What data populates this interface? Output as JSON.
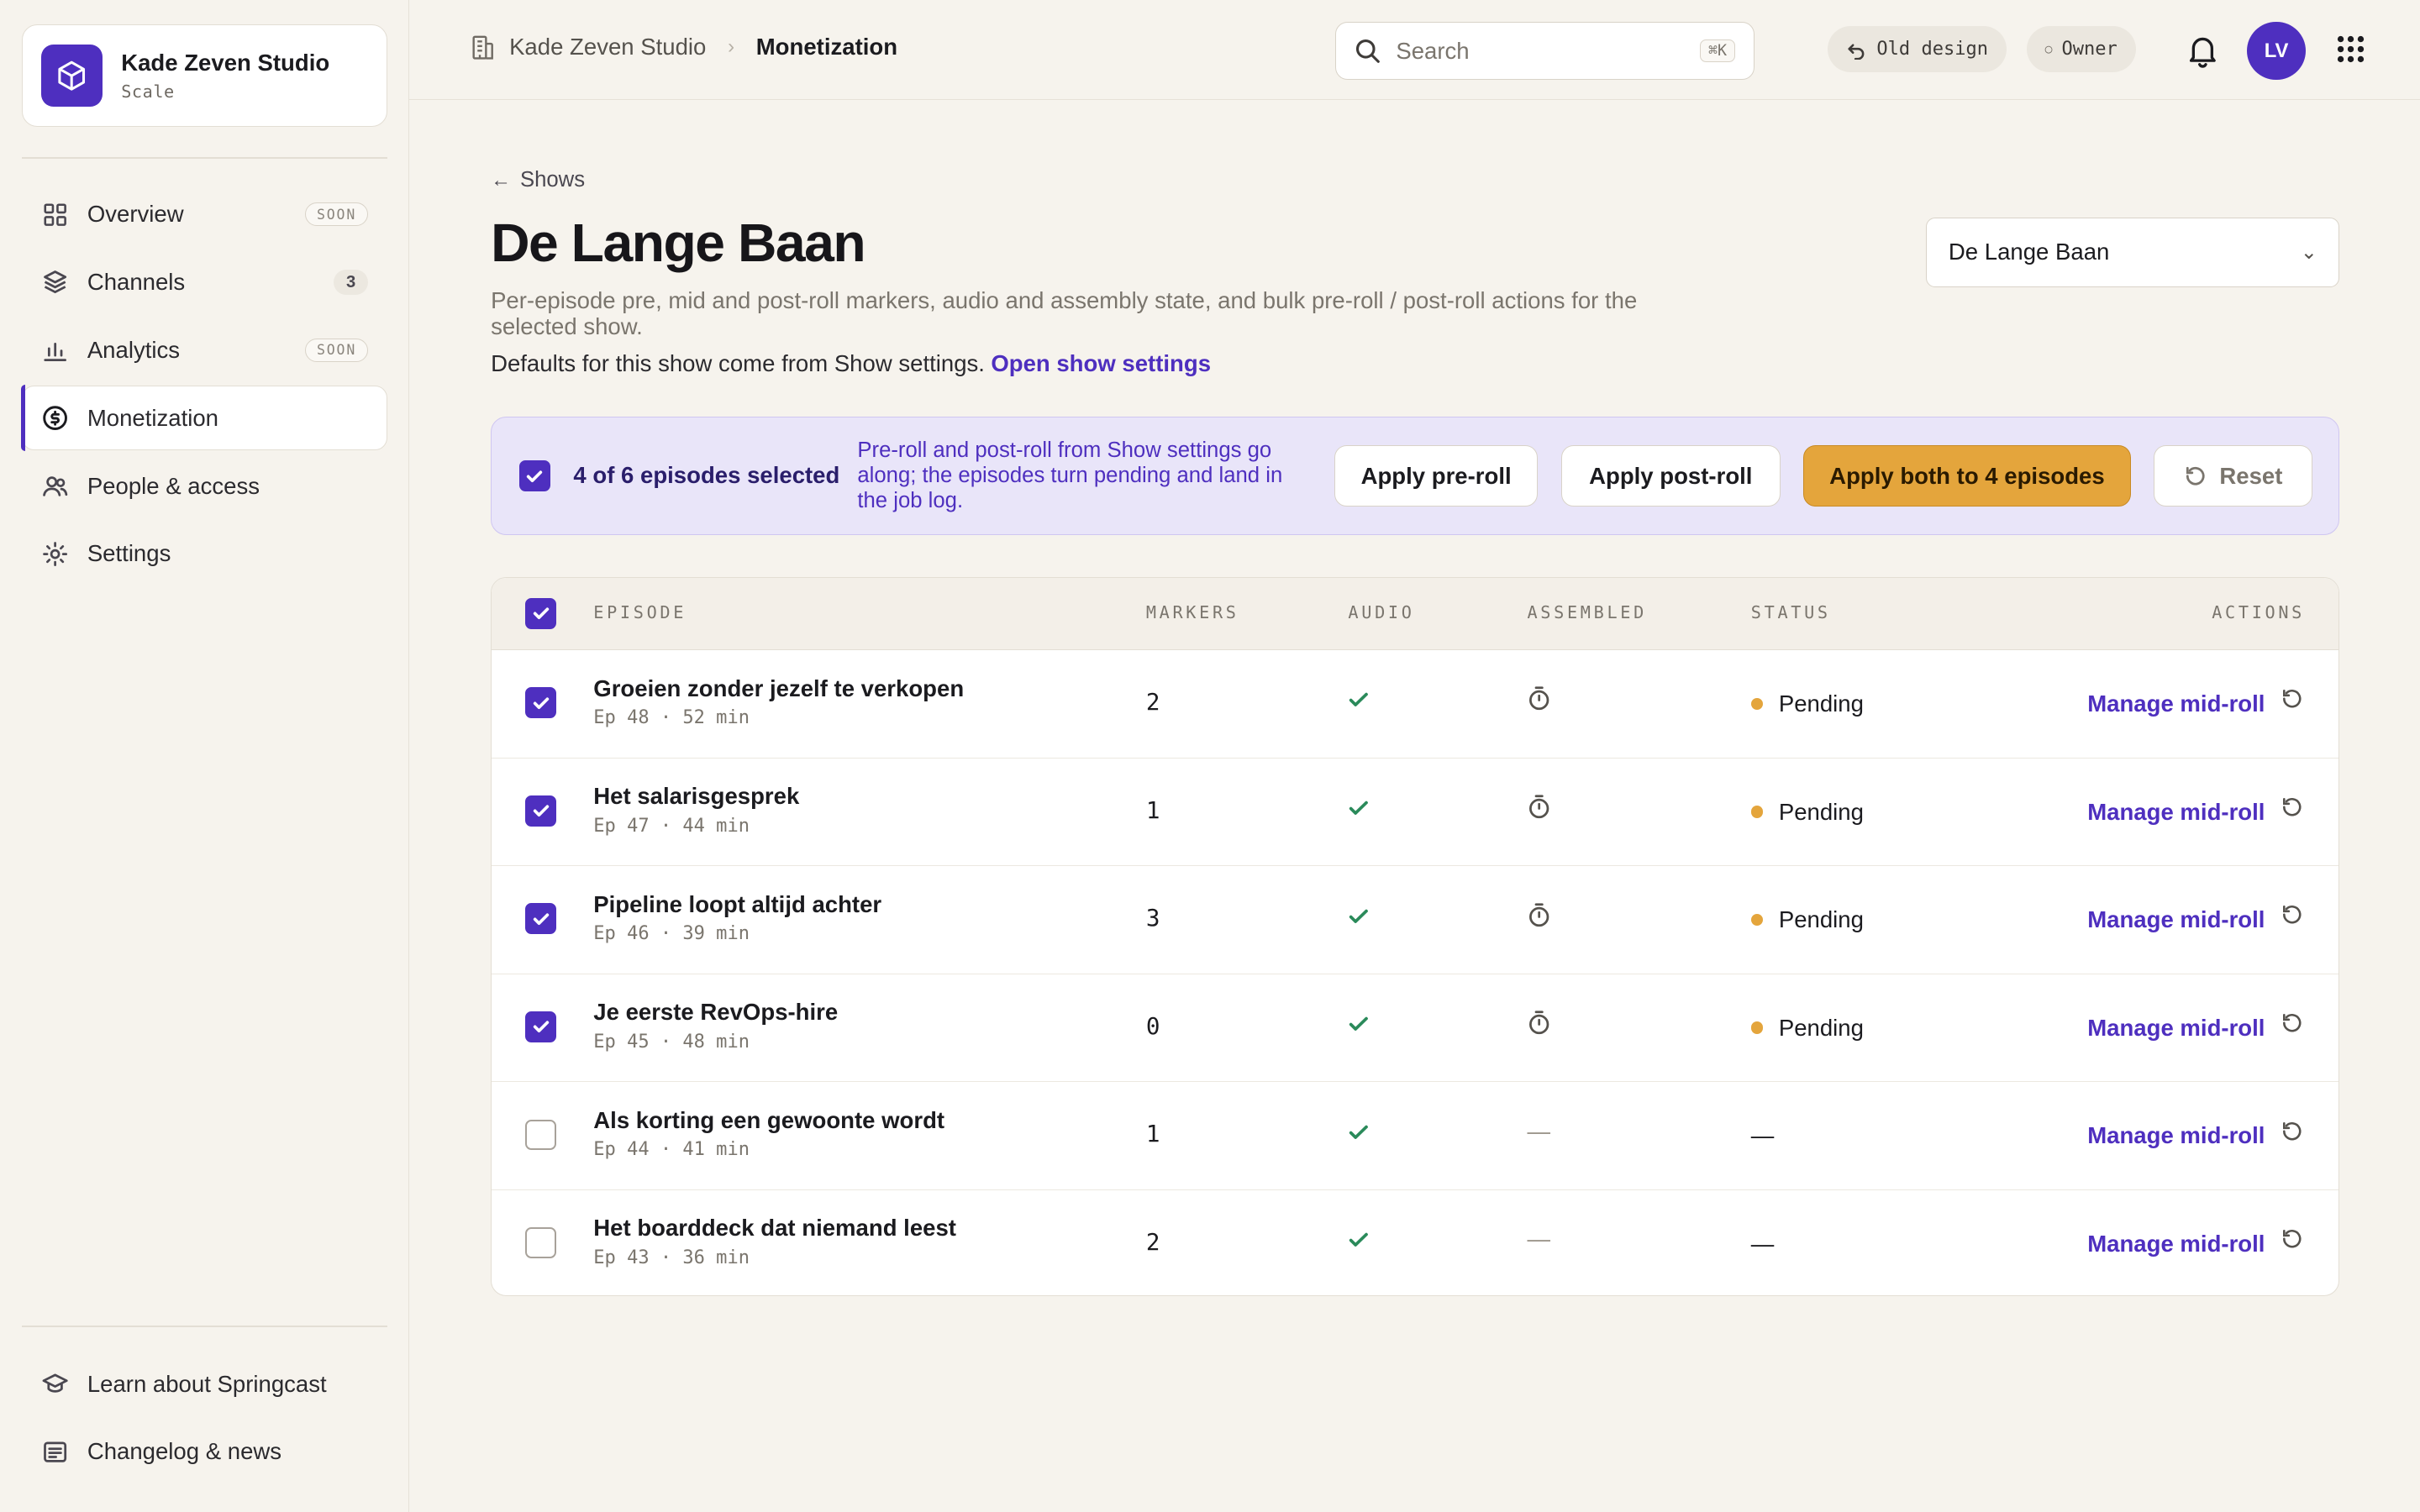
{
  "org": {
    "name": "Kade Zeven Studio",
    "plan": "Scale",
    "logo_icon": "cube-icon"
  },
  "nav": {
    "items": [
      {
        "label": "Overview",
        "icon": "grid-icon",
        "badge": "SOON"
      },
      {
        "label": "Channels",
        "icon": "layers-icon",
        "badge": "3"
      },
      {
        "label": "Analytics",
        "icon": "bar-chart-icon",
        "badge": "SOON"
      },
      {
        "label": "Monetization",
        "icon": "coin-icon",
        "active": true
      },
      {
        "label": "People & access",
        "icon": "users-icon"
      },
      {
        "label": "Settings",
        "icon": "gear-icon"
      }
    ],
    "bottom": [
      {
        "label": "Learn about Springcast",
        "icon": "graduation-cap-icon"
      },
      {
        "label": "Changelog & news",
        "icon": "news-icon"
      }
    ]
  },
  "topbar": {
    "breadcrumb_org": "Kade Zeven Studio",
    "breadcrumb_current": "Monetization",
    "search_placeholder": "Search",
    "search_shortcut": "⌘K",
    "old_design_label": "Old design",
    "role_label": "Owner",
    "avatar_initials": "LV"
  },
  "page": {
    "back_label": "Shows",
    "title": "De Lange Baan",
    "subtitle": "Per-episode pre, mid and post-roll markers, audio and assembly state, and bulk pre-roll / post-roll actions for the selected show.",
    "defaults_text": "Defaults for this show come from Show settings.",
    "defaults_link": "Open show settings",
    "show_select_value": "De Lange Baan"
  },
  "bulk": {
    "count_text": "4 of 6 episodes selected",
    "note": "Pre-roll and post-roll from Show settings go along; the episodes turn pending and land in the job log.",
    "apply_pre": "Apply pre-roll",
    "apply_post": "Apply post-roll",
    "apply_both": "Apply both to 4 episodes",
    "reset": "Reset"
  },
  "table": {
    "headers": {
      "episode": "EPISODE",
      "markers": "MARKERS",
      "audio": "AUDIO",
      "assembled": "ASSEMBLED",
      "status": "STATUS",
      "actions": "ACTIONS"
    },
    "manage_label": "Manage mid-roll",
    "rows": [
      {
        "selected": true,
        "title": "Groeien zonder jezelf te verkopen",
        "meta": "Ep 48 · 52 min",
        "markers": "2",
        "audio": "check",
        "assembled": "timer",
        "status": "Pending"
      },
      {
        "selected": true,
        "title": "Het salarisgesprek",
        "meta": "Ep 47 · 44 min",
        "markers": "1",
        "audio": "check",
        "assembled": "timer",
        "status": "Pending"
      },
      {
        "selected": true,
        "title": "Pipeline loopt altijd achter",
        "meta": "Ep 46 · 39 min",
        "markers": "3",
        "audio": "check",
        "assembled": "timer",
        "status": "Pending"
      },
      {
        "selected": true,
        "title": "Je eerste RevOps-hire",
        "meta": "Ep 45 · 48 min",
        "markers": "0",
        "audio": "check",
        "assembled": "timer",
        "status": "Pending"
      },
      {
        "selected": false,
        "title": "Als korting een gewoonte wordt",
        "meta": "Ep 44 · 41 min",
        "markers": "1",
        "audio": "check",
        "assembled": "—",
        "status": "—"
      },
      {
        "selected": false,
        "title": "Het boarddeck dat niemand leest",
        "meta": "Ep 43 · 36 min",
        "markers": "2",
        "audio": "check",
        "assembled": "—",
        "status": "—"
      }
    ]
  },
  "colors": {
    "accent": "#4e2fbf",
    "pending": "#e4a53c",
    "success": "#2a8a5a",
    "background": "#f6f3ed"
  }
}
